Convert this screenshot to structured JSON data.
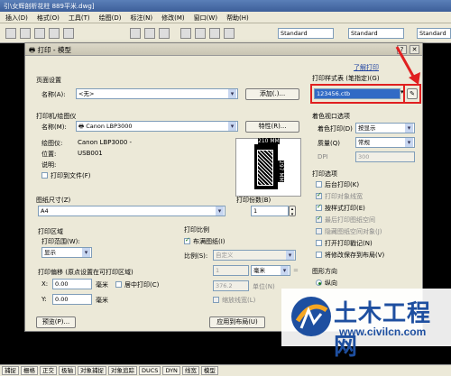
{
  "app": {
    "title": "引\\女辉剖析花柱 889平米.dwg]"
  },
  "menubar": {
    "items": [
      "插入(D)",
      "格式(O)",
      "工具(T)",
      "绘图(D)",
      "标注(N)",
      "修改(M)",
      "窗口(W)",
      "帮助(H)"
    ]
  },
  "toolbar": {
    "text_style": "Standard",
    "dim_style": "Standard",
    "table_style": "Standard"
  },
  "dialog": {
    "title": "打印 - 模型",
    "help_link": "了解打印",
    "page_setup": {
      "group": "页面设置",
      "name_label": "名称(A):",
      "name_value": "<无>",
      "add_button": "添加(.)..."
    },
    "printer": {
      "group": "打印机/绘图仪",
      "name_label": "名称(M):",
      "name_value": "Canon LBP3000",
      "properties_button": "特性(R)...",
      "plotter_label": "绘图仪:",
      "plotter_value": "Canon LBP3000 -",
      "location_label": "位置:",
      "location_value": "USB001",
      "description_label": "说明:",
      "print_to_file": "打印到文件(F)",
      "preview_width": "210 MM",
      "preview_height": "297 MM"
    },
    "paper_size": {
      "group": "图纸尺寸(Z)",
      "value": "A4"
    },
    "copies": {
      "group": "打印份数(B)",
      "value": "1"
    },
    "plot_area": {
      "group": "打印区域",
      "range_label": "打印范围(W):",
      "range_value": "显示"
    },
    "plot_offset": {
      "group": "打印偏移 (原点设置在可打印区域)",
      "x_label": "X:",
      "x_value": "0.00",
      "x_unit": "毫米",
      "center_label": "居中打印(C)",
      "y_label": "Y:",
      "y_value": "0.00",
      "y_unit": "毫米"
    },
    "plot_scale": {
      "group": "打印比例",
      "fit_label": "布满图纸(I)",
      "scale_label": "比例(S):",
      "scale_value": "自定义",
      "num_value": "1",
      "num_unit": "毫米",
      "den_value": "376.2",
      "den_unit": "单位(N)",
      "lineweights_label": "缩放线宽(L)"
    },
    "plot_style_table": {
      "group": "打印样式表 (笔指定)(G)",
      "value": "123456.ctb",
      "edit_icon": "edit-pen-icon"
    },
    "shaded_viewport": {
      "group": "着色视口选项",
      "shade_label": "着色打印(D)",
      "shade_value": "按显示",
      "quality_label": "质量(Q)",
      "quality_value": "常规",
      "dpi_label": "DPI",
      "dpi_value": "300"
    },
    "plot_options": {
      "group": "打印选项",
      "items": [
        {
          "label": "后台打印(K)",
          "checked": false,
          "disabled": false
        },
        {
          "label": "打印对象线宽",
          "checked": true,
          "disabled": true
        },
        {
          "label": "按样式打印(E)",
          "checked": true,
          "disabled": false
        },
        {
          "label": "最后打印图纸空间",
          "checked": true,
          "disabled": true
        },
        {
          "label": "隐藏图纸空间对象(J)",
          "checked": false,
          "disabled": true
        },
        {
          "label": "打开打印戳记(N)",
          "checked": false,
          "disabled": false
        },
        {
          "label": "将修改保存到布局(V)",
          "checked": false,
          "disabled": false
        }
      ]
    },
    "orientation": {
      "group": "图形方向",
      "portrait": "纵向"
    },
    "preview_button": "预览(P)...",
    "apply_button": "应用到布局(U)"
  },
  "status": {
    "items": [
      "捕捉",
      "栅格",
      "正交",
      "极轴",
      "对象捕捉",
      "对象追踪",
      "DUCS",
      "DYN",
      "线宽",
      "模型"
    ]
  },
  "watermark": {
    "text": "土木工程网",
    "url": "www.civilcn.com"
  },
  "colors": {
    "highlight_red": "#e02020",
    "selection_blue": "#316ac5",
    "dialog_bg": "#ece9d8",
    "brand_blue": "#1e4fa0"
  }
}
